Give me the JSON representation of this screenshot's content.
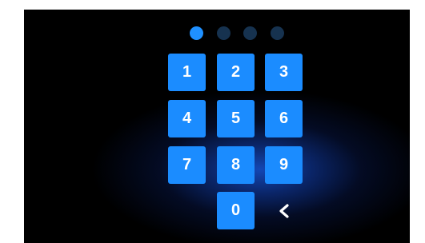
{
  "pin": {
    "length": 4,
    "entered": 1,
    "filled_color": "#1f90ff",
    "empty_color": "#16324f"
  },
  "keypad": {
    "keys": [
      "1",
      "2",
      "3",
      "4",
      "5",
      "6",
      "7",
      "8",
      "9",
      "0"
    ],
    "key_color": "#1b8cff",
    "backspace_icon": "chevron-left-icon"
  }
}
